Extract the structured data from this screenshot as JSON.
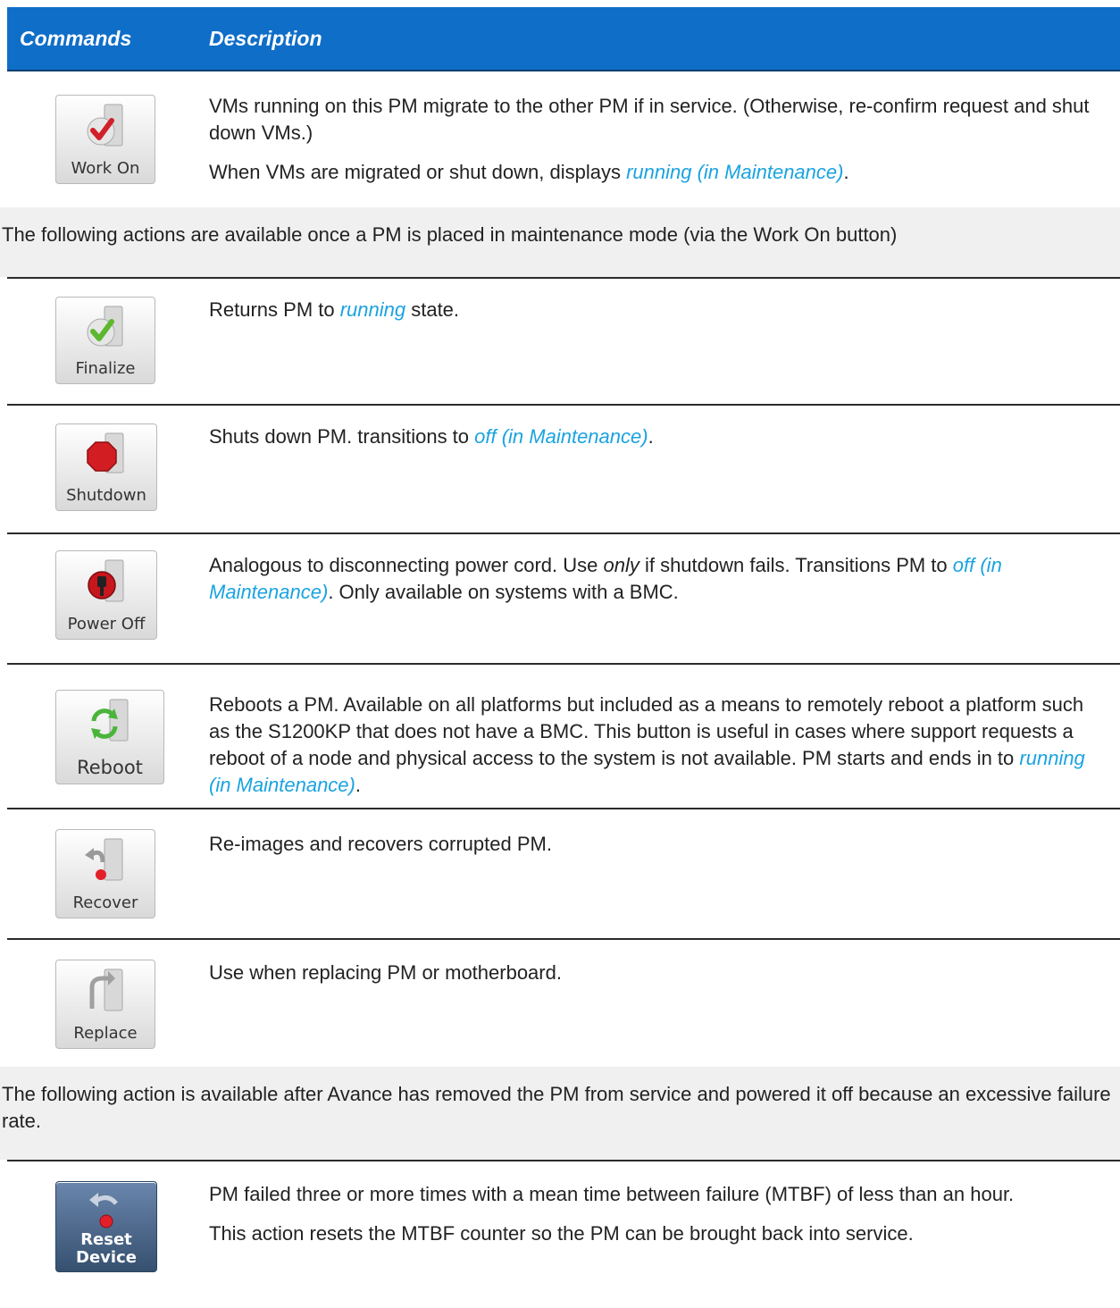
{
  "header": {
    "col1": "Commands",
    "col2": "Description"
  },
  "rows": [
    {
      "button": "Work On",
      "p1a": "VMs running on this PM migrate to the other PM if in service. (Otherwise, re-confirm request and shut down VMs.)",
      "p2a": "When VMs are migrated or shut down, displays ",
      "p2b": "running (in Maintenance)",
      "p2c": "."
    },
    {
      "button": "Finalize",
      "a": "Returns PM to ",
      "b": "running",
      "c": " state."
    },
    {
      "button": "Shutdown",
      "a": "Shuts down PM. transitions to ",
      "b": "off (in Maintenance)",
      "c": "."
    },
    {
      "button": "Power Off",
      "a": "Analogous to disconnecting power cord. Use ",
      "b": "only",
      "c": " if shutdown fails.  Transitions PM to ",
      "d": "off (in Maintenance)",
      "e": ". Only available on systems with a BMC."
    },
    {
      "button": "Reboot",
      "a": "Reboots a PM. Available on all platforms but included as a means to remotely reboot a platform such as the S1200KP that does not have a BMC. This button is useful in cases where support requests a reboot of a node and physical access to the system is not available. PM starts and ends in to ",
      "b": "running (in Maintenance)",
      "c": "."
    },
    {
      "button": "Recover",
      "a": "Re-images and recovers corrupted PM."
    },
    {
      "button": "Replace",
      "a": "Use when replacing PM or motherboard."
    },
    {
      "button_line1": "Reset",
      "button_line2": "Device",
      "p1": "PM failed three or more times with a mean time between failure (MTBF) of less than an hour.",
      "p2": "This action resets the MTBF counter so the PM can be brought back into service."
    }
  ],
  "notes": {
    "maintenance": "The following actions are available once a PM is placed in maintenance mode (via the Work On button)",
    "removed": "The following action is available after Avance has removed the PM from service and powered it off because an excessive failure rate."
  },
  "colors": {
    "header_bg": "#0f6ec8",
    "link_italic": "#1aa3e0",
    "band_bg": "#f0f0f0"
  },
  "icons": [
    "check-red-icon",
    "check-green-icon",
    "stop-sign-icon",
    "power-plug-icon",
    "refresh-icon",
    "recover-arrow-icon",
    "replace-arrow-icon",
    "reset-arrow-icon"
  ]
}
